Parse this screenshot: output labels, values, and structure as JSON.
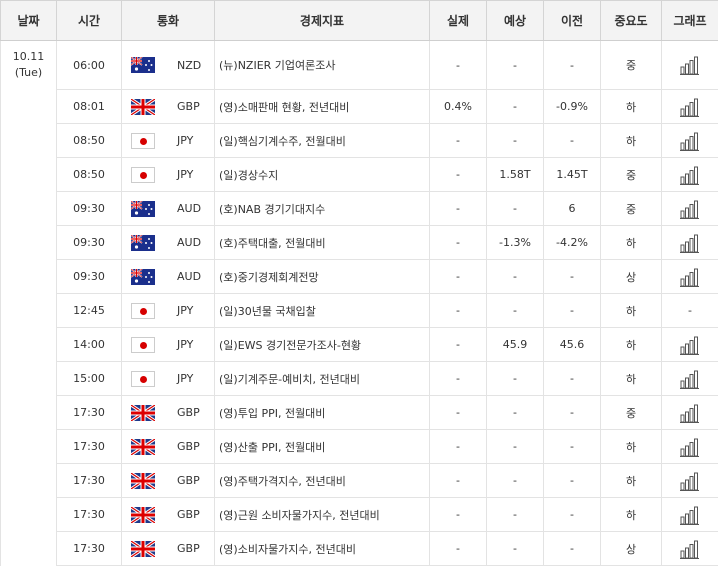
{
  "headers": {
    "date": "날짜",
    "time": "시간",
    "currency": "통화",
    "indicator": "경제지표",
    "actual": "실제",
    "forecast": "예상",
    "previous": "이전",
    "importance": "중요도",
    "graph": "그래프"
  },
  "date": {
    "day": "10.11",
    "weekday": "(Tue)"
  },
  "rows": [
    {
      "time": "06:00",
      "flag": "au",
      "currency": "NZD",
      "indicator": "(뉴)NZIER 기업여론조사",
      "actual": "-",
      "forecast": "-",
      "previous": "-",
      "importance": "중",
      "graph": true
    },
    {
      "time": "08:01",
      "flag": "gb",
      "currency": "GBP",
      "indicator": "(영)소매판매 현황, 전년대비",
      "actual": "0.4%",
      "forecast": "-",
      "previous": "-0.9%",
      "importance": "하",
      "graph": true
    },
    {
      "time": "08:50",
      "flag": "jp",
      "currency": "JPY",
      "indicator": "(일)핵심기계수주, 전월대비",
      "actual": "-",
      "forecast": "-",
      "previous": "-",
      "importance": "하",
      "graph": true
    },
    {
      "time": "08:50",
      "flag": "jp",
      "currency": "JPY",
      "indicator": "(일)경상수지",
      "actual": "-",
      "forecast": "1.58T",
      "previous": "1.45T",
      "importance": "중",
      "graph": true
    },
    {
      "time": "09:30",
      "flag": "au",
      "currency": "AUD",
      "indicator": "(호)NAB 경기기대지수",
      "actual": "-",
      "forecast": "-",
      "previous": "6",
      "importance": "중",
      "graph": true
    },
    {
      "time": "09:30",
      "flag": "au",
      "currency": "AUD",
      "indicator": "(호)주택대출, 전월대비",
      "actual": "-",
      "forecast": "-1.3%",
      "previous": "-4.2%",
      "importance": "하",
      "graph": true
    },
    {
      "time": "09:30",
      "flag": "au",
      "currency": "AUD",
      "indicator": "(호)중기경제회계전망",
      "actual": "-",
      "forecast": "-",
      "previous": "-",
      "importance": "상",
      "graph": true
    },
    {
      "time": "12:45",
      "flag": "jp",
      "currency": "JPY",
      "indicator": "(일)30년물 국채입찰",
      "actual": "-",
      "forecast": "-",
      "previous": "-",
      "importance": "하",
      "graph": false,
      "graph_text": "-"
    },
    {
      "time": "14:00",
      "flag": "jp",
      "currency": "JPY",
      "indicator": "(일)EWS 경기전문가조사-현황",
      "actual": "-",
      "forecast": "45.9",
      "previous": "45.6",
      "importance": "하",
      "graph": true
    },
    {
      "time": "15:00",
      "flag": "jp",
      "currency": "JPY",
      "indicator": "(일)기계주문-예비치, 전년대비",
      "actual": "-",
      "forecast": "-",
      "previous": "-",
      "importance": "하",
      "graph": true
    },
    {
      "time": "17:30",
      "flag": "gb",
      "currency": "GBP",
      "indicator": "(영)투입 PPI, 전월대비",
      "actual": "-",
      "forecast": "-",
      "previous": "-",
      "importance": "중",
      "graph": true
    },
    {
      "time": "17:30",
      "flag": "gb",
      "currency": "GBP",
      "indicator": "(영)산출 PPI, 전월대비",
      "actual": "-",
      "forecast": "-",
      "previous": "-",
      "importance": "하",
      "graph": true
    },
    {
      "time": "17:30",
      "flag": "gb",
      "currency": "GBP",
      "indicator": "(영)주택가격지수, 전년대비",
      "actual": "-",
      "forecast": "-",
      "previous": "-",
      "importance": "하",
      "graph": true
    },
    {
      "time": "17:30",
      "flag": "gb",
      "currency": "GBP",
      "indicator": "(영)근원 소비자물가지수, 전년대비",
      "actual": "-",
      "forecast": "-",
      "previous": "-",
      "importance": "하",
      "graph": true
    },
    {
      "time": "17:30",
      "flag": "gb",
      "currency": "GBP",
      "indicator": "(영)소비자물가지수, 전년대비",
      "actual": "-",
      "forecast": "-",
      "previous": "-",
      "importance": "상",
      "graph": true
    }
  ]
}
